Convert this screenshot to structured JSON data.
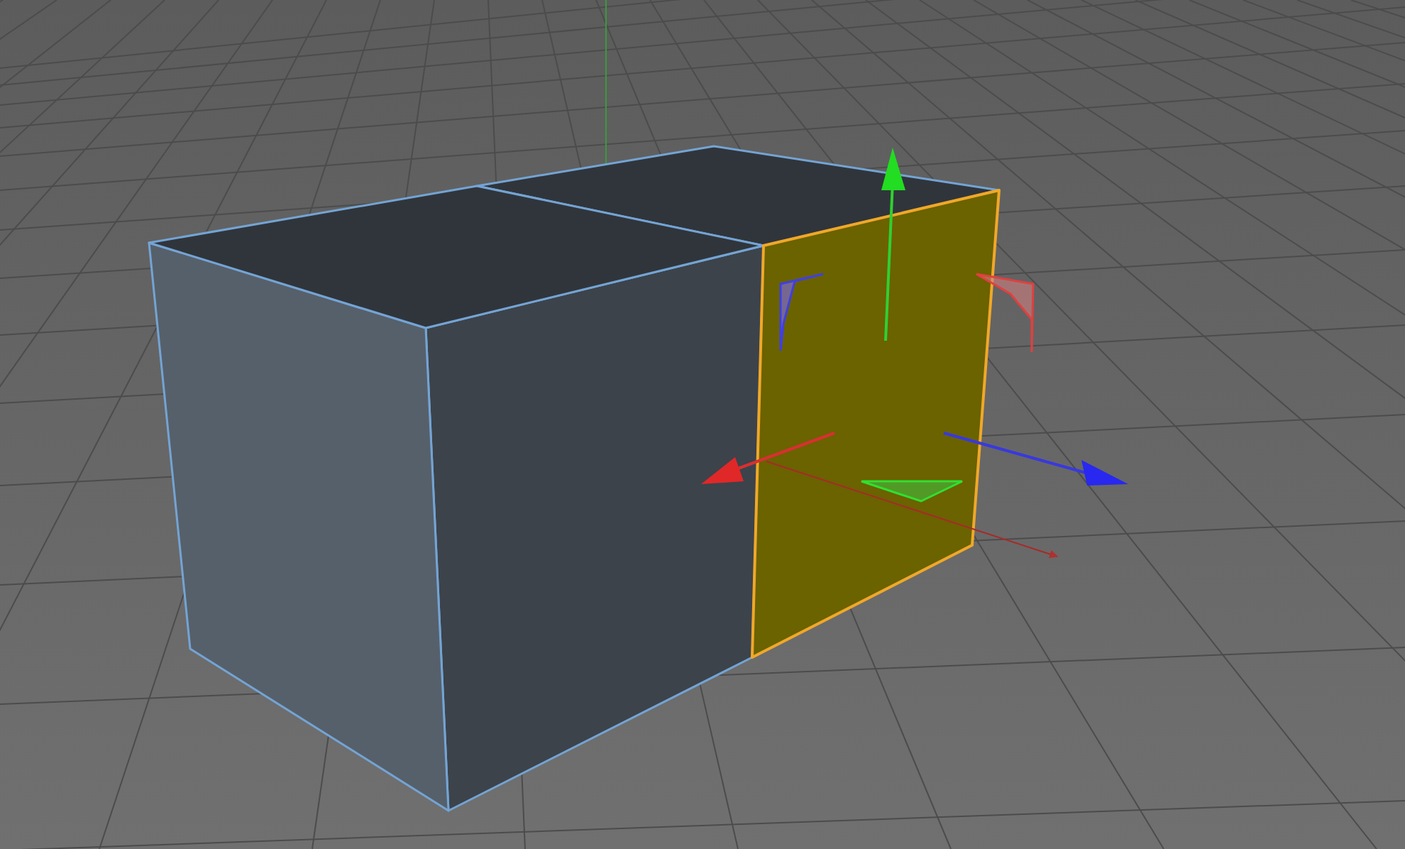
{
  "viewport": {
    "faces": [
      {
        "selected": false
      },
      {
        "selected": false
      },
      {
        "selected": false
      },
      {
        "selected": false
      },
      {
        "selected": true
      }
    ]
  }
}
